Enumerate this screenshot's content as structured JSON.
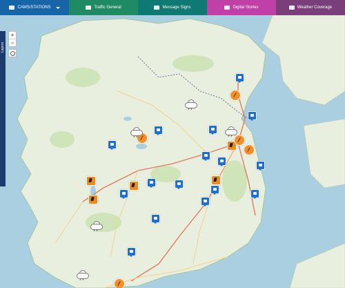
{
  "nav": {
    "tabs": [
      {
        "key": "cams",
        "label": "CAMS/STATIONS",
        "icon": "camera-icon",
        "color": "#1565a8",
        "has_dropdown": true
      },
      {
        "key": "traffic",
        "label": "Traffic General",
        "icon": "car-icon",
        "color": "#1f8a63"
      },
      {
        "key": "message",
        "label": "Message Signs",
        "icon": "sign-icon",
        "color": "#0f7a73"
      },
      {
        "key": "digital",
        "label": "Digital Stories",
        "icon": "digital-sign-icon",
        "color": "#c040a8"
      },
      {
        "key": "weather",
        "label": "Weather Coverage",
        "icon": "cloud-icon",
        "color": "#7a3f7a"
      }
    ]
  },
  "map_controls": {
    "zoom_in": "+",
    "zoom_out": "−",
    "layers_label": "Layers",
    "locate_icon": "locate-icon"
  },
  "map": {
    "colors": {
      "sea": "#a9cfe0",
      "land": "#e8efdf",
      "green": "#cfe4b8",
      "road_major": "#e07a5f",
      "road_minor": "#f4d38a",
      "border": "#7a6a9a"
    },
    "marker_types": {
      "camera": "camera-marker-icon",
      "roadwork": "roadwork-marker-icon",
      "incident": "incident-marker-icon",
      "weather": "rain-cloud-icon"
    }
  }
}
